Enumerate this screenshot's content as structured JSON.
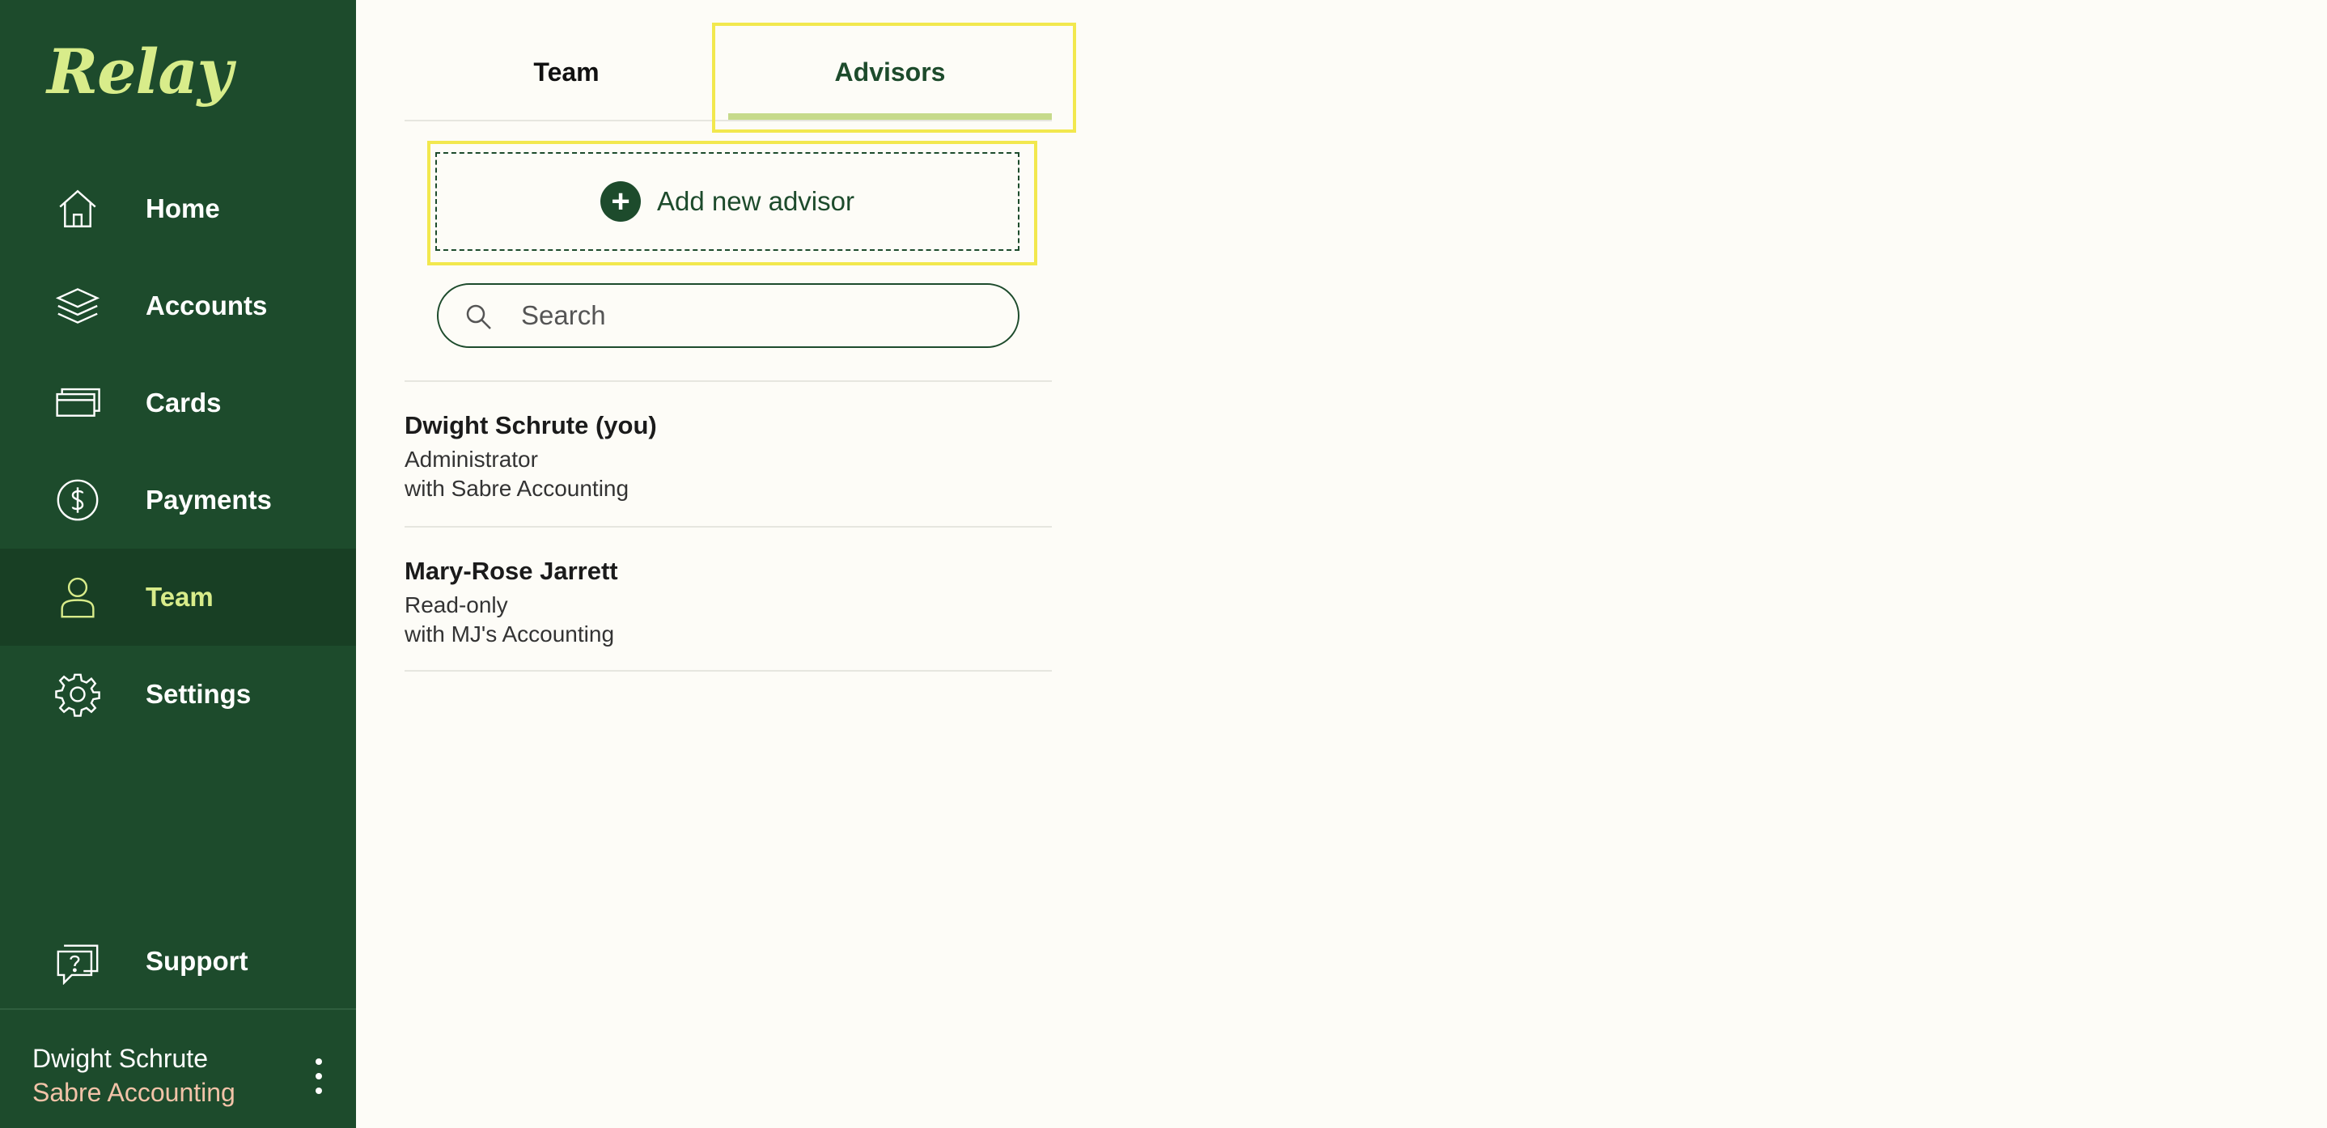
{
  "app": {
    "logo": "Relay"
  },
  "sidebar": {
    "items": [
      {
        "label": "Home",
        "icon": "home-icon"
      },
      {
        "label": "Accounts",
        "icon": "layers-icon"
      },
      {
        "label": "Cards",
        "icon": "cards-icon"
      },
      {
        "label": "Payments",
        "icon": "dollar-circle-icon"
      },
      {
        "label": "Team",
        "icon": "person-icon",
        "active": true
      },
      {
        "label": "Settings",
        "icon": "gear-icon"
      },
      {
        "label": "Support",
        "icon": "help-chat-icon"
      }
    ],
    "user": {
      "name": "Dwight Schrute",
      "org": "Sabre Accounting"
    }
  },
  "tabs": [
    {
      "label": "Team",
      "active": false
    },
    {
      "label": "Advisors",
      "active": true
    }
  ],
  "actions": {
    "add_advisor_label": "Add new advisor"
  },
  "search": {
    "placeholder": "Search",
    "value": ""
  },
  "advisors": [
    {
      "name": "Dwight Schrute (you)",
      "role": "Administrator",
      "org": "with Sabre Accounting"
    },
    {
      "name": "Mary-Rose Jarrett",
      "role": "Read-only",
      "org": "with MJ's Accounting"
    }
  ],
  "colors": {
    "sidebar_bg": "#1d4b2c",
    "accent": "#d8ec8a",
    "highlight": "#f2e84e",
    "page_bg": "#fdfcf7"
  }
}
